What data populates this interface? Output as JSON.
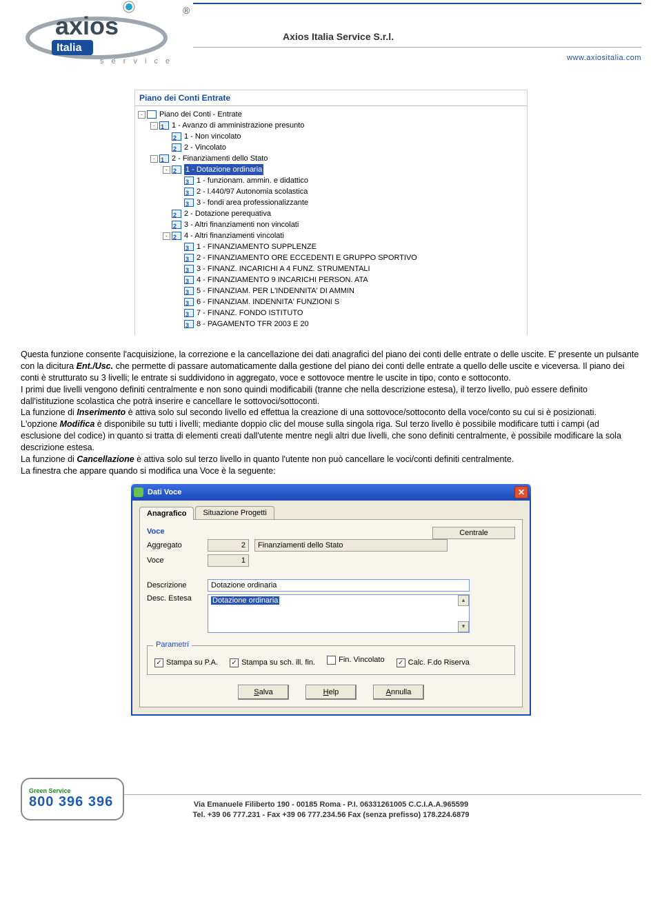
{
  "header": {
    "company_name": "Axios Italia Service S.r.l.",
    "url": "www.axiositalia.com",
    "logo": {
      "brand_top": "axios",
      "brand_bottom": "Italia",
      "brand_sub": "s e r v i c e",
      "registered": "®"
    }
  },
  "tree": {
    "title": "Piano dei Conti Entrate",
    "nodes": [
      {
        "level": 0,
        "twist": "-",
        "icon": "root",
        "label": "Piano dei Conti - Entrate"
      },
      {
        "level": 1,
        "twist": "-",
        "icon": "1",
        "label": "1 - Avanzo di amministrazione presunto"
      },
      {
        "level": 2,
        "twist": "",
        "icon": "2",
        "label": "1 - Non vincolato"
      },
      {
        "level": 2,
        "twist": "",
        "icon": "2",
        "label": "2 - Vincolato"
      },
      {
        "level": 1,
        "twist": "-",
        "icon": "1",
        "label": "2 - Finanziamenti dello Stato"
      },
      {
        "level": 2,
        "twist": "-",
        "icon": "2",
        "label": "1 - Dotazione ordinaria",
        "selected": true
      },
      {
        "level": 3,
        "twist": "",
        "icon": "3",
        "label": "1 - funzionam. ammin. e didattico"
      },
      {
        "level": 3,
        "twist": "",
        "icon": "3",
        "label": "2 - l.440/97 Autonomia scolastica"
      },
      {
        "level": 3,
        "twist": "",
        "icon": "3",
        "label": "3 - fondi area professionalizzante"
      },
      {
        "level": 2,
        "twist": "",
        "icon": "2",
        "label": "2 - Dotazione perequativa"
      },
      {
        "level": 2,
        "twist": "",
        "icon": "2",
        "label": "3 - Altri finanziamenti non vincolati"
      },
      {
        "level": 2,
        "twist": "-",
        "icon": "2",
        "label": "4 - Altri finanziamenti vincolati"
      },
      {
        "level": 3,
        "twist": "",
        "icon": "3",
        "label": "1 - FINANZIAMENTO SUPPLENZE"
      },
      {
        "level": 3,
        "twist": "",
        "icon": "3",
        "label": "2 - FINANZIAMENTO ORE ECCEDENTI E GRUPPO SPORTIVO"
      },
      {
        "level": 3,
        "twist": "",
        "icon": "3",
        "label": "3 - FINANZ. INCARICHI A 4 FUNZ. STRUMENTALI"
      },
      {
        "level": 3,
        "twist": "",
        "icon": "3",
        "label": "4 - FINANZIAMENTO 9 INCARICHI PERSON. ATA"
      },
      {
        "level": 3,
        "twist": "",
        "icon": "3",
        "label": "5 - FINANZIAM. PER L'INDENNITA' DI AMMIN"
      },
      {
        "level": 3,
        "twist": "",
        "icon": "3",
        "label": "6 - FINANZIAM. INDENNITA' FUNZIONI S"
      },
      {
        "level": 3,
        "twist": "",
        "icon": "3",
        "label": "7 - FINANZ. FONDO ISTITUTO"
      },
      {
        "level": 3,
        "twist": "",
        "icon": "3",
        "label": "8 - PAGAMENTO TFR 2003 E 20"
      }
    ]
  },
  "doc": {
    "p1a": "Questa funzione consente l'acquisizione, la correzione e la cancellazione dei dati anagrafici del piano dei conti delle entrate o delle uscite. E' presente un pulsante con la dicitura ",
    "p1_em": "Ent./Usc.",
    "p1b": " che permette di passare automaticamente dalla gestione del piano dei conti delle entrate a quello delle uscite e viceversa. Il piano dei conti è strutturato su 3 livelli; le entrate si suddividono in aggregato, voce e sottovoce mentre le uscite in tipo, conto e sottoconto.",
    "p2": "I primi due livelli vengono definiti centralmente e non sono quindi modificabili (tranne che nella descrizione estesa), il terzo livello, può essere definito dall'istituzione scolastica che potrà inserire e cancellare le sottovoci/sottoconti.",
    "p3a": "La funzione di ",
    "p3_em": "Inserimento",
    "p3b": " è attiva solo sul secondo livello ed effettua la creazione di una sottovoce/sottoconto della voce/conto su cui si è posizionati.",
    "p4a": "L'opzione ",
    "p4_em": "Modifica",
    "p4b": " è disponibile su tutti i livelli; mediante doppio clic del mouse sulla singola riga. Sul terzo livello è possibile modificare tutti i campi (ad esclusione del codice) in quanto si tratta di elementi creati dall'utente mentre negli altri due livelli, che sono definiti centralmente, è possibile modificare la sola descrizione estesa.",
    "p5a": "La funzione di ",
    "p5_em": "Cancellazione",
    "p5b": " è attiva solo sul terzo livello in quanto l'utente non può cancellare le voci/conti definiti centralmente.",
    "p6": "La finestra che appare quando si modifica una Voce è la seguente:"
  },
  "dialog": {
    "title": "Dati Voce",
    "tabs": {
      "anagrafico": "Anagrafico",
      "situazione": "Situazione Progetti"
    },
    "section_voce": "Voce",
    "origin_badge": "Centrale",
    "labels": {
      "aggregato": "Aggregato",
      "voce": "Voce",
      "descrizione": "Descrizione",
      "desc_estesa": "Desc. Estesa"
    },
    "values": {
      "aggregato_code": "2",
      "aggregato_desc": "Finanziamenti dello Stato",
      "voce_code": "1",
      "descrizione": "Dotazione ordinaria",
      "desc_estesa": "Dotazione ordinaria"
    },
    "params": {
      "legend": "Parametri",
      "stampa_pa": "Stampa su P.A.",
      "stampa_sch": "Stampa su sch. ill. fin.",
      "fin_vinc": "Fin. Vincolato",
      "calc_riserva": "Calc. F.do Riserva"
    },
    "buttons": {
      "salva": "Salva",
      "salva_u": "S",
      "help": "Help",
      "help_u": "H",
      "annulla": "Annulla",
      "annulla_u": "A"
    }
  },
  "footer": {
    "green_service": "Green Service",
    "phone": "800 396 396",
    "address": "Via Emanuele Filiberto 190 - 00185 Roma - P.I. 06331261005 C.C.I.A.A.965599",
    "tel": "Tel. +39 06 777.231 - Fax +39 06 777.234.56 Fax (senza prefisso) 178.224.6879"
  }
}
